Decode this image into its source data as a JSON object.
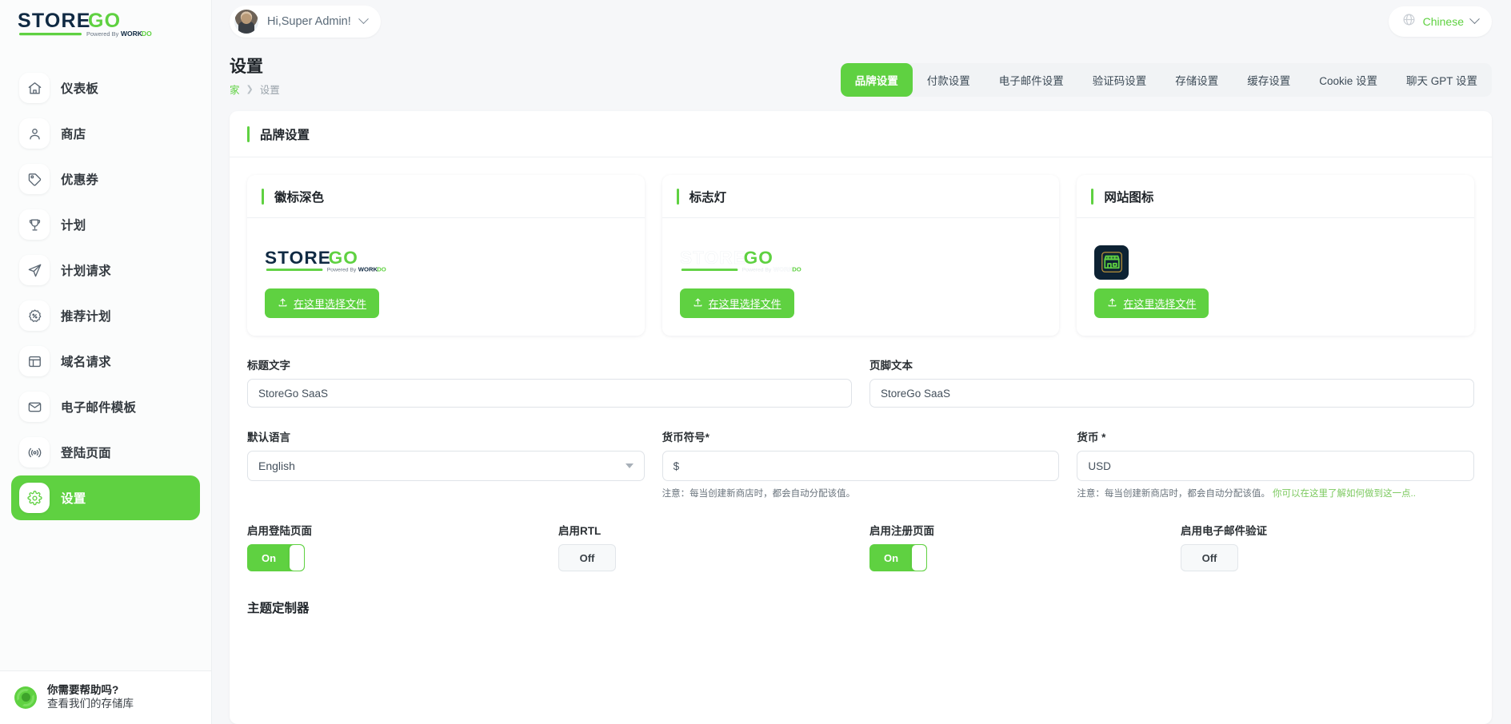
{
  "brand": {
    "logo_main": "STORE",
    "logo_accent": "GO",
    "logo_tagline": "Powered By WORKDO",
    "accent_color": "#5fd141",
    "dark_color": "#102a43"
  },
  "sidebar": {
    "items": [
      {
        "label": "仪表板",
        "icon": "home-icon",
        "active": false
      },
      {
        "label": "商店",
        "icon": "user-icon",
        "active": false
      },
      {
        "label": "优惠券",
        "icon": "tag-icon",
        "active": false
      },
      {
        "label": "计划",
        "icon": "trophy-icon",
        "active": false
      },
      {
        "label": "计划请求",
        "icon": "send-icon",
        "active": false
      },
      {
        "label": "推荐计划",
        "icon": "percent-badge-icon",
        "active": false
      },
      {
        "label": "域名请求",
        "icon": "window-icon",
        "active": false
      },
      {
        "label": "电子邮件模板",
        "icon": "mail-icon",
        "active": false
      },
      {
        "label": "登陆页面",
        "icon": "broadcast-icon",
        "active": false
      },
      {
        "label": "设置",
        "icon": "gear-icon",
        "active": true
      }
    ],
    "help": {
      "title": "你需要帮助吗?",
      "subtitle": "查看我们的存储库"
    }
  },
  "topbar": {
    "user_greeting": "Hi,Super Admin!",
    "language": "Chinese"
  },
  "header": {
    "title": "设置",
    "breadcrumb_home": "家",
    "breadcrumb_sep": "❯",
    "breadcrumb_current": "设置"
  },
  "tabs": [
    {
      "label": "品牌设置",
      "active": true
    },
    {
      "label": "付款设置",
      "active": false
    },
    {
      "label": "电子邮件设置",
      "active": false
    },
    {
      "label": "验证码设置",
      "active": false
    },
    {
      "label": "存储设置",
      "active": false
    },
    {
      "label": "缓存设置",
      "active": false
    },
    {
      "label": "Cookie 设置",
      "active": false
    },
    {
      "label": "聊天 GPT 设置",
      "active": false
    }
  ],
  "panel": {
    "section_title": "品牌设置",
    "cards": [
      {
        "title": "徽标深色",
        "upload_label": "在这里选择文件",
        "preview": "storego-logo-dark"
      },
      {
        "title": "标志灯",
        "upload_label": "在这里选择文件",
        "preview": "storego-logo-light"
      },
      {
        "title": "网站图标",
        "upload_label": "在这里选择文件",
        "preview": "storefront-favicon"
      }
    ],
    "fields": {
      "title_text": {
        "label": "标题文字",
        "value": "StoreGo SaaS"
      },
      "footer_text": {
        "label": "页脚文本",
        "value": "StoreGo SaaS"
      },
      "default_language": {
        "label": "默认语言",
        "value": "English"
      },
      "currency_symbol": {
        "label": "货币符号*",
        "value": "$",
        "hint": "注意：每当创建新商店时，都会自动分配该值。"
      },
      "currency": {
        "label": "货币 *",
        "value": "USD",
        "hint": "注意：每当创建新商店时，都会自动分配该值。",
        "hint_link": "你可以在这里了解如何做到这一点.."
      }
    },
    "toggles": [
      {
        "label": "启用登陆页面",
        "state": "On",
        "on": true
      },
      {
        "label": "启用RTL",
        "state": "Off",
        "on": false
      },
      {
        "label": "启用注册页面",
        "state": "On",
        "on": true
      },
      {
        "label": "启用电子邮件验证",
        "state": "Off",
        "on": false
      }
    ],
    "theme_title": "主题定制器"
  }
}
